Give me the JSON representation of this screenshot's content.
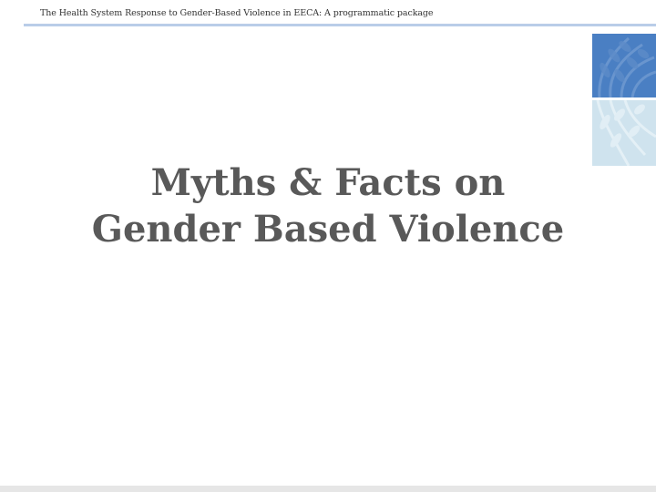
{
  "header": {
    "text": "The Health System Response to Gender-Based Violence in EECA: A programmatic package"
  },
  "slide": {
    "title_line1": "Myths & Facts on",
    "title_line2": "Gender Based Violence"
  },
  "colors": {
    "header_rule": "#b9cde8",
    "logo_top": "#4a7fc3",
    "logo_bottom": "#cfe3ee",
    "title": "#595959"
  },
  "icons": {
    "logo": "un-laurel-emblem-icon"
  }
}
